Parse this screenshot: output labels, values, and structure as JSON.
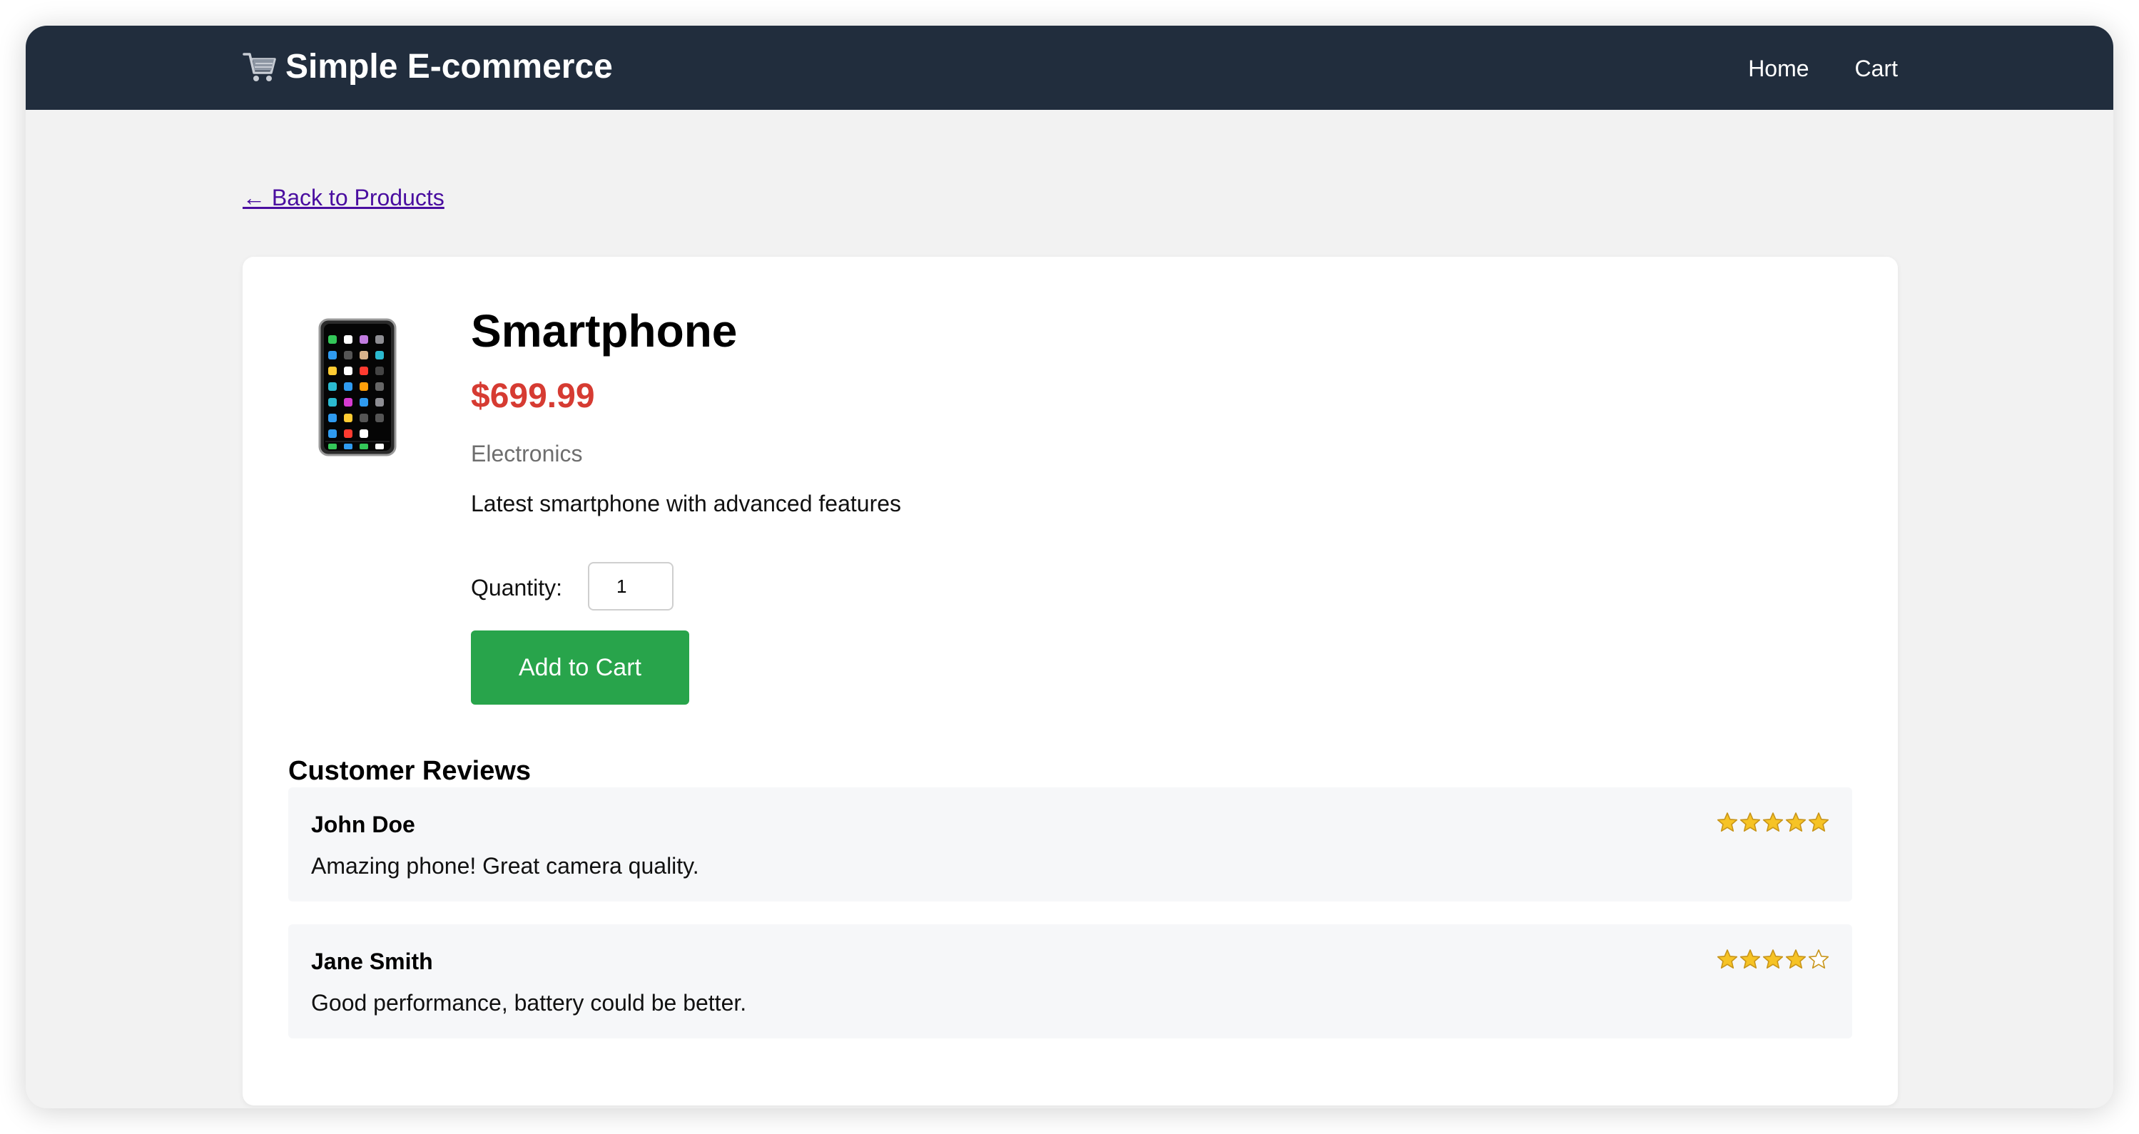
{
  "header": {
    "brand": "Simple E-commerce",
    "brand_icon": "shopping-cart-icon",
    "nav": [
      {
        "label": "Home"
      },
      {
        "label": "Cart"
      }
    ]
  },
  "back_link": "← Back to Products",
  "product": {
    "image_icon": "smartphone-icon",
    "title": "Smartphone",
    "price": "$699.99",
    "category": "Electronics",
    "description": "Latest smartphone with advanced features",
    "quantity_label": "Quantity:",
    "quantity_value": "1",
    "add_button": "Add to Cart"
  },
  "reviews": {
    "title": "Customer Reviews",
    "items": [
      {
        "name": "John Doe",
        "text": "Amazing phone! Great camera quality.",
        "rating": 5,
        "max": 5
      },
      {
        "name": "Jane Smith",
        "text": "Good performance, battery could be better.",
        "rating": 4,
        "max": 5
      }
    ]
  },
  "colors": {
    "navbar": "#212d3d",
    "price": "#d63b32",
    "button": "#28a44b",
    "link": "#4a0ea0",
    "star": "#f6c325"
  }
}
